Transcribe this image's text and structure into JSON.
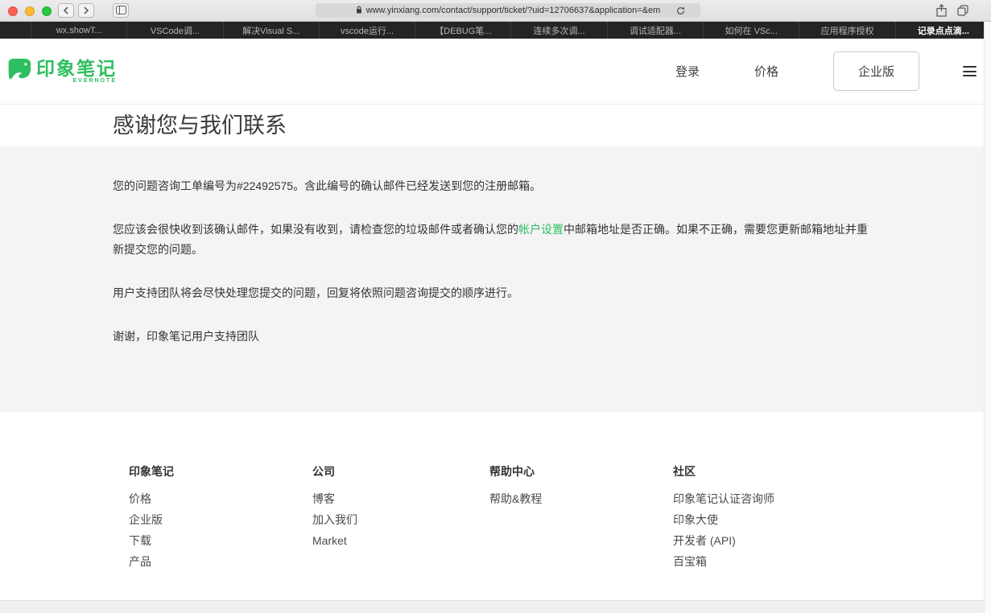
{
  "colors": {
    "accent_green": "#2dbe60"
  },
  "browser": {
    "url": "www.yinxiang.com/contact/support/ticket/?uid=12706637&application=&em",
    "tabs": [
      {
        "label": "wx.showT..."
      },
      {
        "label": "VSCode调..."
      },
      {
        "label": "解决Visual S..."
      },
      {
        "label": "vscode运行..."
      },
      {
        "label": "【DEBUG笔..."
      },
      {
        "label": "连续多次调..."
      },
      {
        "label": "调试适配器..."
      },
      {
        "label": "如何在 VSc..."
      },
      {
        "label": "应用程序授权"
      },
      {
        "label": "记录点点滴...",
        "active": true
      }
    ]
  },
  "header": {
    "logo_text": "印象笔记",
    "logo_sub": "EVERNOTE",
    "nav_login": "登录",
    "nav_pricing": "价格",
    "nav_business": "企业版"
  },
  "main": {
    "title": "感谢您与我们联系",
    "p1": "您的问题咨询工单编号为#22492575。含此编号的确认邮件已经发送到您的注册邮箱。",
    "p2_pre": "您应该会很快收到该确认邮件，如果没有收到，请检查您的垃圾邮件或者确认您的",
    "p2_link": "帐户设置",
    "p2_post": "中邮箱地址是否正确。如果不正确，需要您更新邮箱地址并重新提交您的问题。",
    "p3": "用户支持团队将会尽快处理您提交的问题，回复将依照问题咨询提交的顺序进行。",
    "p4": "谢谢，印象笔记用户支持团队"
  },
  "footer": {
    "columns": [
      {
        "title": "印象笔记",
        "items": [
          "价格",
          "企业版",
          "下载",
          "产品"
        ]
      },
      {
        "title": "公司",
        "items": [
          "博客",
          "加入我们",
          "Market"
        ]
      },
      {
        "title": "帮助中心",
        "items": [
          "帮助&教程"
        ]
      },
      {
        "title": "社区",
        "items": [
          "印象笔记认证咨询师",
          "印象大使",
          "开发者 (API)",
          "百宝箱"
        ]
      }
    ]
  }
}
